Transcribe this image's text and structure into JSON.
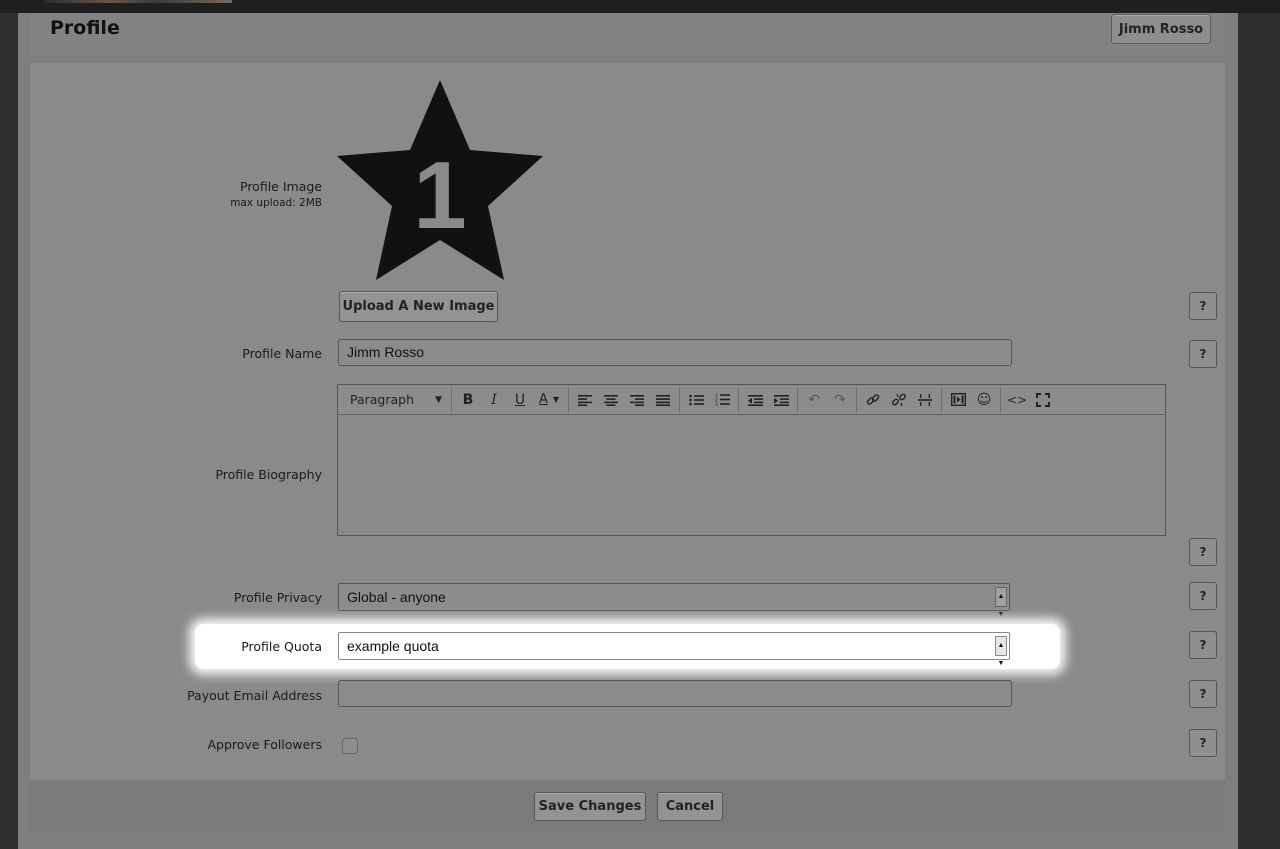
{
  "header": {
    "title": "Profile",
    "user_button": "Jimm Rosso"
  },
  "profile_image": {
    "label": "Profile Image",
    "sublabel": "max upload: 2MB",
    "image_number": "1",
    "upload_button": "Upload A New Image"
  },
  "profile_name": {
    "label": "Profile Name",
    "value": "Jimm Rosso"
  },
  "biography": {
    "label": "Profile Biography",
    "format_select": "Paragraph",
    "toolbar_icons": [
      "bold-icon",
      "italic-icon",
      "underline-icon",
      "text-color-icon",
      "align-left-icon",
      "align-center-icon",
      "align-right-icon",
      "align-justify-icon",
      "bullet-list-icon",
      "numbered-list-icon",
      "outdent-icon",
      "indent-icon",
      "undo-icon",
      "redo-icon",
      "link-icon",
      "unlink-icon",
      "horizontal-rule-icon",
      "media-icon",
      "emoticon-icon",
      "source-code-icon",
      "fullscreen-icon"
    ]
  },
  "privacy": {
    "label": "Profile Privacy",
    "value": "Global - anyone"
  },
  "quota": {
    "label": "Profile Quota",
    "value": "example quota"
  },
  "payout": {
    "label": "Payout Email Address",
    "value": ""
  },
  "approve": {
    "label": "Approve Followers"
  },
  "help_label": "?",
  "footer": {
    "save": "Save Changes",
    "cancel": "Cancel"
  }
}
